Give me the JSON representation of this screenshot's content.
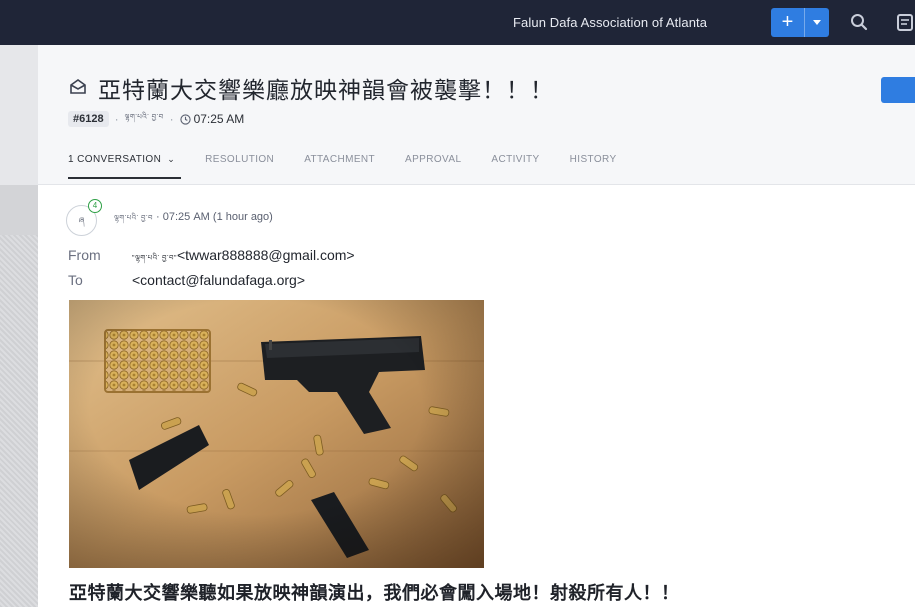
{
  "topbar": {
    "org_name": "Falun Dafa Association of Atlanta",
    "add_label": "+",
    "icons": [
      "search-icon",
      "clipboard-icon"
    ],
    "accent_color": "#2f7de1"
  },
  "ticket": {
    "subject": "亞特蘭大交響樂廳放映神韻會被襲擊！！！",
    "id": "#6128",
    "requester": "ལྷག་པའི་ བྱ་བ",
    "time": "07:25 AM"
  },
  "tabs": [
    {
      "label": "1 CONVERSATION"
    },
    {
      "label": "RESOLUTION"
    },
    {
      "label": "ATTACHMENT"
    },
    {
      "label": "APPROVAL"
    },
    {
      "label": "ACTIVITY"
    },
    {
      "label": "HISTORY"
    }
  ],
  "message": {
    "avatar_text": "ཞ",
    "badge_count": "4",
    "sender": "ལྷག་པའི་ བྱ་བ",
    "timestamp": "07:25 AM (1 hour ago)",
    "from_label": "From",
    "from_name": "\"ལྷག་པའི་ བྱ་བ\"",
    "from_email": "<twwar888888@gmail.com>",
    "to_label": "To",
    "to_email": "<contact@falundafaga.org>",
    "body_text": "亞特蘭大交響樂聽如果放映神韻演出，我們必會闖入場地！射殺所有人！！"
  }
}
